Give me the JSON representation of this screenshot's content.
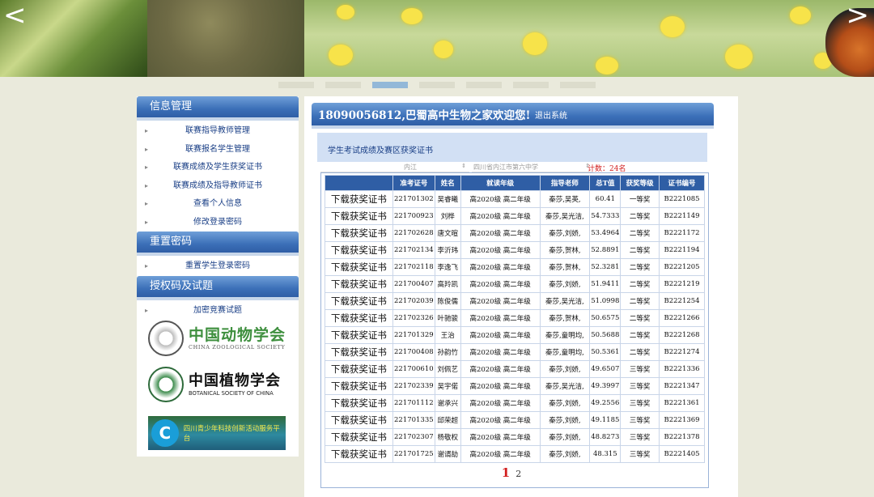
{
  "banner": {
    "prev_icon": "<",
    "next_icon": ">",
    "slide_count": 7,
    "active_slide": 3
  },
  "sidebar": {
    "sections": [
      {
        "title": "信息管理",
        "items": [
          "联赛指导教师管理",
          "联赛报名学生管理",
          "联赛成绩及学生获奖证书",
          "联赛成绩及指导教师证书",
          "查看个人信息",
          "修改登录密码"
        ]
      },
      {
        "title": "重置密码",
        "items": [
          "重置学生登录密码"
        ]
      },
      {
        "title": "授权码及试题",
        "items": [
          "加密竞赛试题"
        ]
      }
    ],
    "logos": {
      "zoology": {
        "cn": "中国动物学会",
        "en": "CHINA ZOOLOGICAL SOCIETY"
      },
      "botany": {
        "cn": "中国植物学会",
        "en": "BOTANICAL SOCIETY OF CHINA"
      },
      "youth": {
        "text": "四川青少年科技创新活动服务平台"
      }
    }
  },
  "main": {
    "welcome": "18090056812,巴蜀高中生物之家欢迎您!",
    "logout": "退出系统",
    "subtitle": "学生考试成绩及赛区获奖证书",
    "filter_city": "内江",
    "filter_school": "四川省内江市第六中学",
    "count_text": "计数：24名",
    "columns": [
      "",
      "准考证号",
      "姓名",
      "就读年级",
      "指导老师",
      "总T值",
      "获奖等级",
      "证书编号"
    ],
    "download_label": "下载获奖证书",
    "rows": [
      [
        "221701302",
        "吴睿曦",
        "高2020级 高二年级",
        "秦莎,吴英,",
        "60.41",
        "一等奖",
        "B2221085"
      ],
      [
        "221700923",
        "刘桦",
        "高2020级 高二年级",
        "秦莎,吴光洁,",
        "54.7333",
        "二等奖",
        "B2221149"
      ],
      [
        "221702628",
        "唐文暄",
        "高2020级 高二年级",
        "秦莎,刘娇,",
        "53.4964",
        "二等奖",
        "B2221172"
      ],
      [
        "221702134",
        "李沂玮",
        "高2020级 高二年级",
        "秦莎,贺林,",
        "52.8891",
        "二等奖",
        "B2221194"
      ],
      [
        "221702118",
        "李逸飞",
        "高2020级 高二年级",
        "秦莎,贺林,",
        "52.3281",
        "二等奖",
        "B2221205"
      ],
      [
        "221700407",
        "高羚凯",
        "高2020级 高二年级",
        "秦莎,刘娇,",
        "51.9411",
        "二等奖",
        "B2221219"
      ],
      [
        "221702039",
        "陈俊儒",
        "高2020级 高二年级",
        "秦莎,吴光洁,",
        "51.0998",
        "二等奖",
        "B2221254"
      ],
      [
        "221702326",
        "叶驰骏",
        "高2020级 高二年级",
        "秦莎,贺林,",
        "50.6575",
        "二等奖",
        "B2221266"
      ],
      [
        "221701329",
        "王治",
        "高2020级 高二年级",
        "秦莎,童明均,",
        "50.5688",
        "二等奖",
        "B2221268"
      ],
      [
        "221700408",
        "孙韵竹",
        "高2020级 高二年级",
        "秦莎,童明均,",
        "50.5361",
        "二等奖",
        "B2221274"
      ],
      [
        "221700610",
        "刘佩艺",
        "高2020级 高二年级",
        "秦莎,刘娇,",
        "49.6507",
        "三等奖",
        "B2221336"
      ],
      [
        "221702339",
        "吴宇偌",
        "高2020级 高二年级",
        "秦莎,吴光洁,",
        "49.3997",
        "三等奖",
        "B2221347"
      ],
      [
        "221701112",
        "谢承兴",
        "高2020级 高二年级",
        "秦莎,刘娇,",
        "49.2556",
        "三等奖",
        "B2221361"
      ],
      [
        "221701335",
        "邱荣超",
        "高2020级 高二年级",
        "秦莎,刘娇,",
        "49.1185",
        "三等奖",
        "B2221369"
      ],
      [
        "221702307",
        "杨敬权",
        "高2020级 高二年级",
        "秦莎,刘娇,",
        "48.8273",
        "三等奖",
        "B2221378"
      ],
      [
        "221701725",
        "谢谞劼",
        "高2020级 高二年级",
        "秦莎,刘娇,",
        "48.315",
        "三等奖",
        "B2221405"
      ]
    ],
    "pager": {
      "current": "1",
      "next": "2"
    }
  }
}
